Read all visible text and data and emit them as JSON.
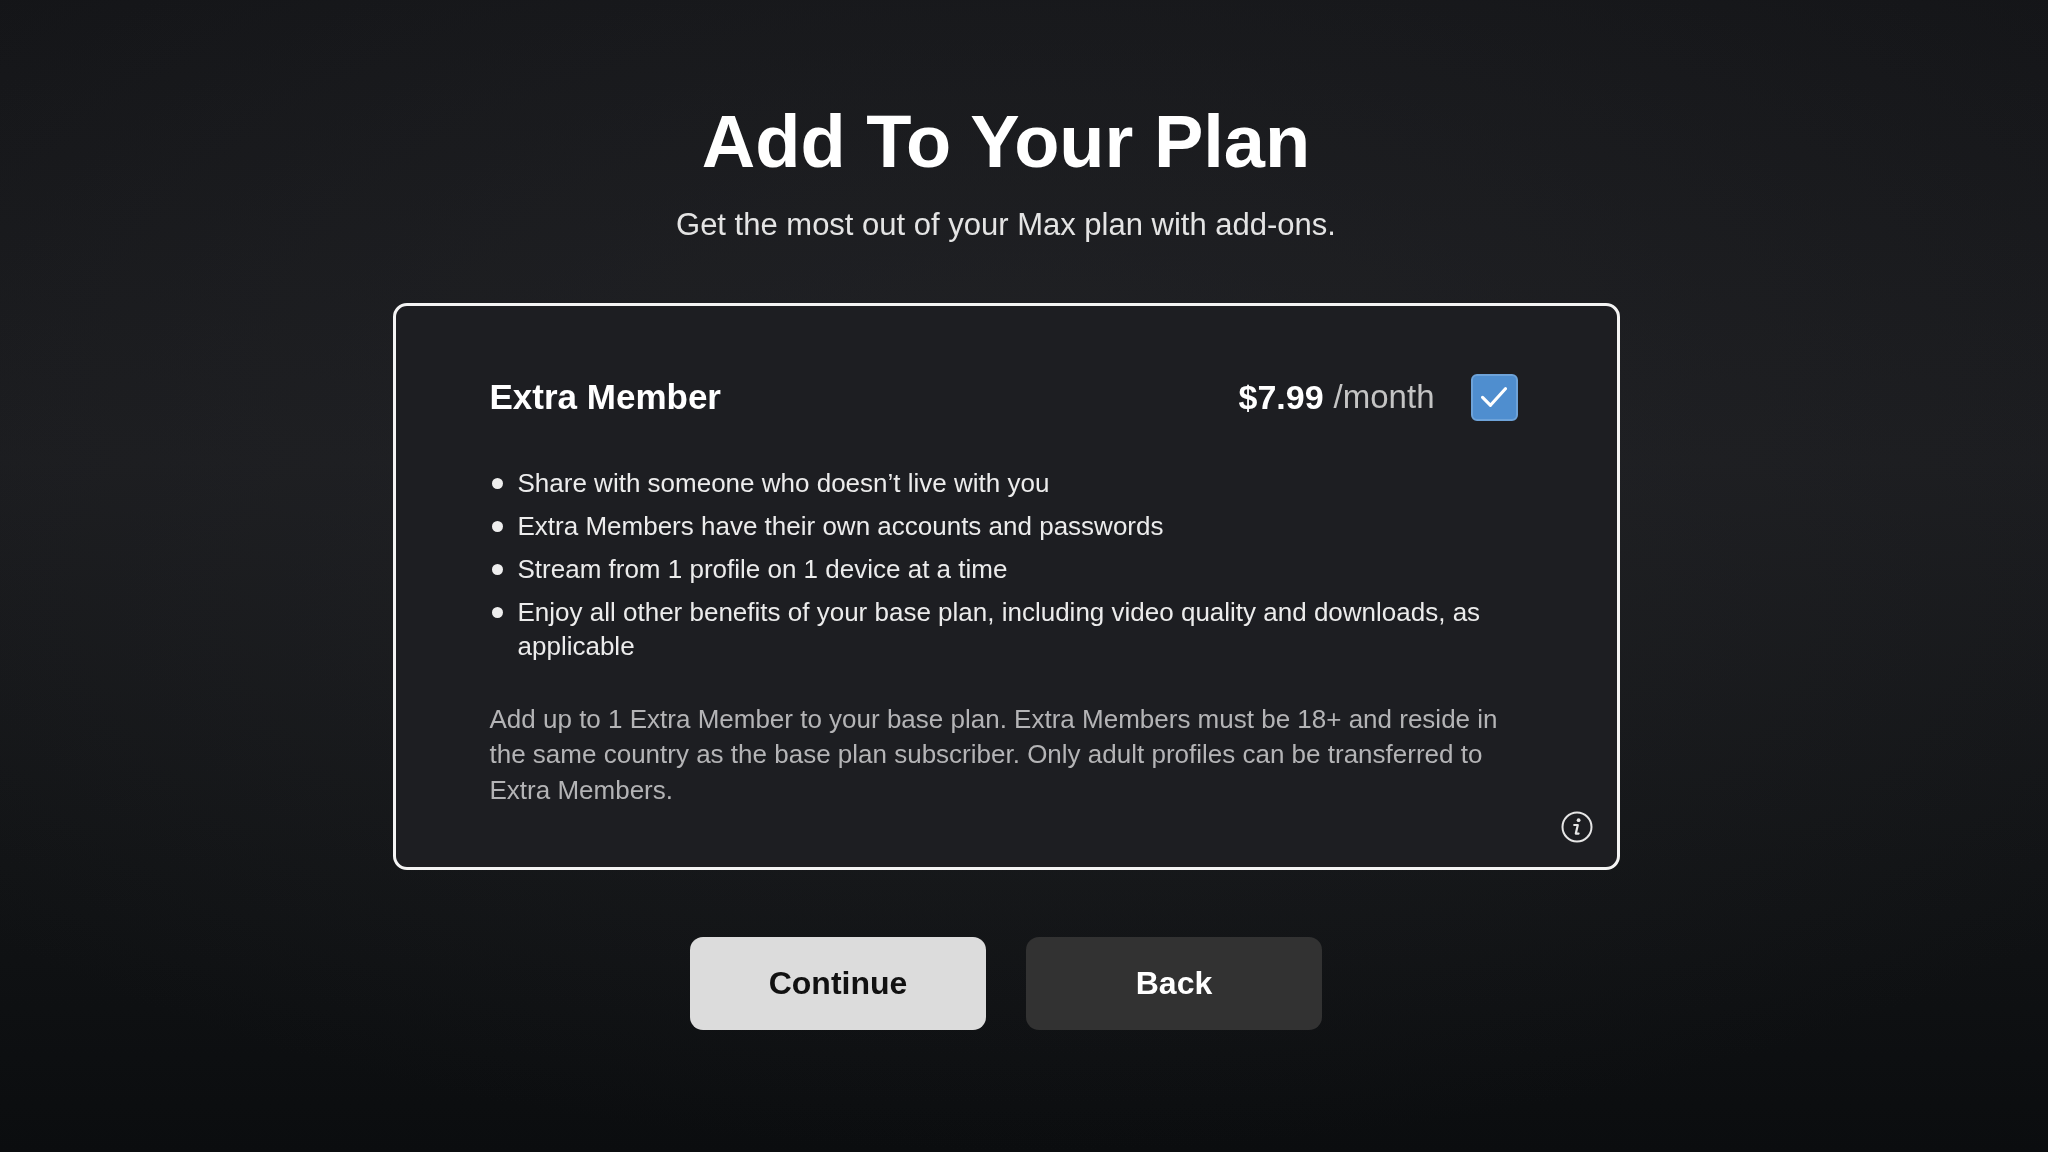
{
  "page": {
    "title": "Add To Your Plan",
    "subtitle": "Get the most out of your Max plan with add-ons."
  },
  "addon": {
    "name": "Extra Member",
    "price": "$7.99",
    "period": "/month",
    "checked": true,
    "features": [
      "Share with someone who doesn’t live with you",
      "Extra Members have their own accounts and passwords",
      "Stream from 1 profile on 1 device at a time",
      "Enjoy all other benefits of your base plan, including video quality and downloads, as applicable"
    ],
    "note": "Add up to 1 Extra Member to your base plan. Extra Members must be 18+ and reside in the same country as the base plan subscriber. Only adult profiles can be transferred to Extra Members."
  },
  "buttons": [
    {
      "label": "Continue",
      "kind": "primary"
    },
    {
      "label": "Back",
      "kind": "secondary"
    }
  ]
}
